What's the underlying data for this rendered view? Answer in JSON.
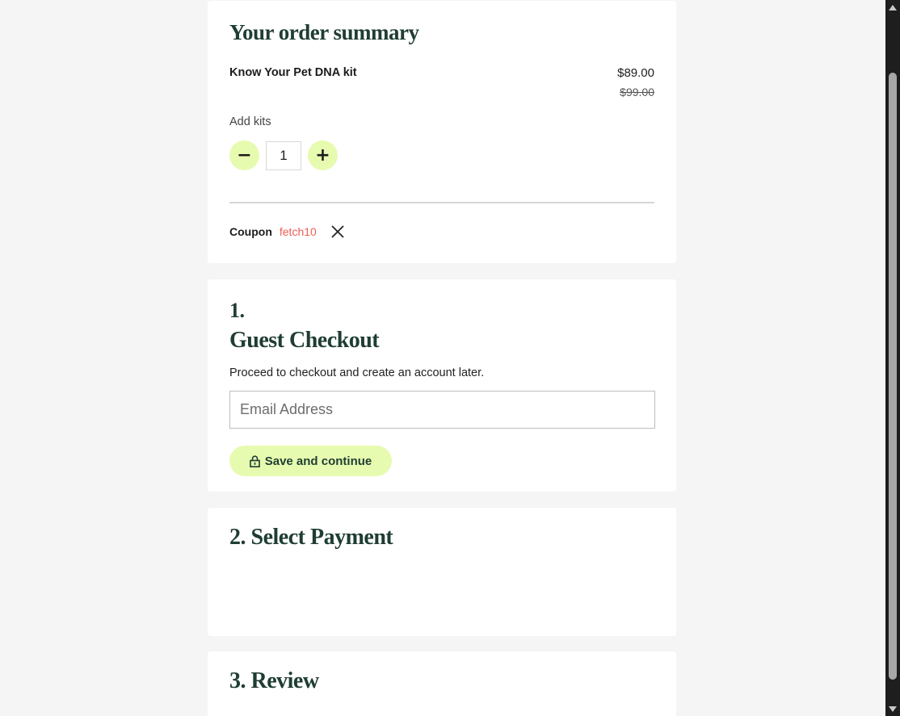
{
  "order_summary": {
    "title": "Your order summary",
    "product_name": "Know Your Pet DNA kit",
    "price": "$89.00",
    "original_price": "$99.00",
    "add_kits_label": "Add kits",
    "decrement_label": "−",
    "quantity": "1",
    "increment_label": "+",
    "coupon_label": "Coupon",
    "coupon_code": "fetch10"
  },
  "guest_checkout": {
    "step_number": "1.",
    "title": "Guest Checkout",
    "description": "Proceed to checkout and create an account later.",
    "email_placeholder": "Email Address",
    "email_value": "",
    "save_button_label": "Save and continue"
  },
  "payment": {
    "title": "2. Select Payment"
  },
  "review": {
    "title": "3. Review"
  },
  "colors": {
    "accent_green": "#e7fbb0",
    "heading_dark_green": "#1f3d33",
    "coupon_red": "#ef5d55",
    "page_background": "#f5f5f5"
  }
}
